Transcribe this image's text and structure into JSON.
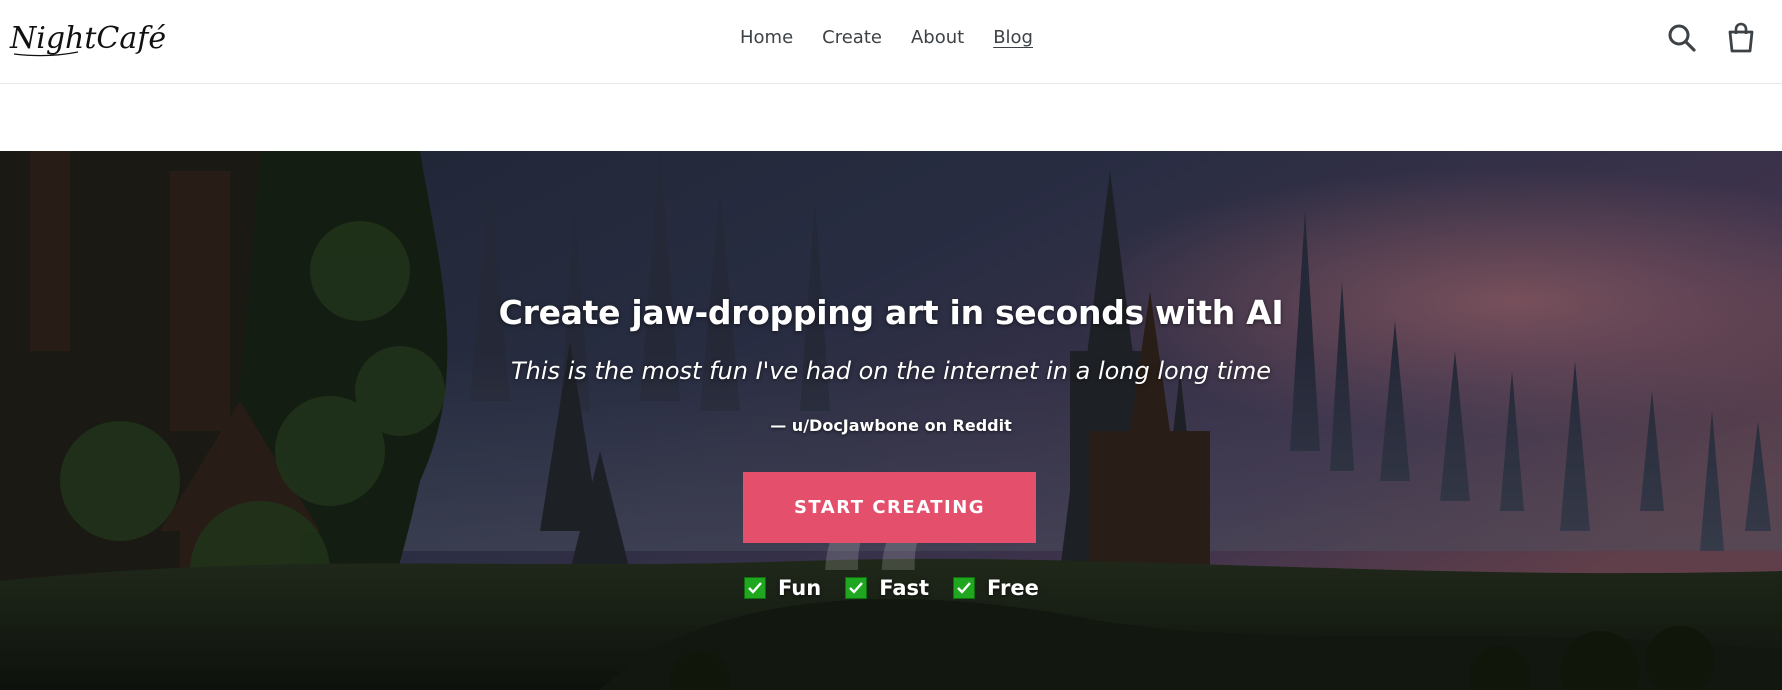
{
  "header": {
    "logo_text": "NightCafé",
    "nav": [
      {
        "label": "Home",
        "active": false
      },
      {
        "label": "Create",
        "active": false
      },
      {
        "label": "About",
        "active": false
      },
      {
        "label": "Blog",
        "active": true
      }
    ],
    "search_icon": "search-icon",
    "cart_icon": "shopping-bag-icon"
  },
  "hero": {
    "title": "Create jaw-dropping art in seconds with AI",
    "quote": "This is the most fun I've had on the internet in a long long time",
    "attribution": "— u/DocJawbone on Reddit",
    "cta_label": "START CREATING",
    "cta_color": "#e4506c",
    "features": [
      "Fun",
      "Fast",
      "Free"
    ],
    "check_color": "#1fa81f"
  }
}
